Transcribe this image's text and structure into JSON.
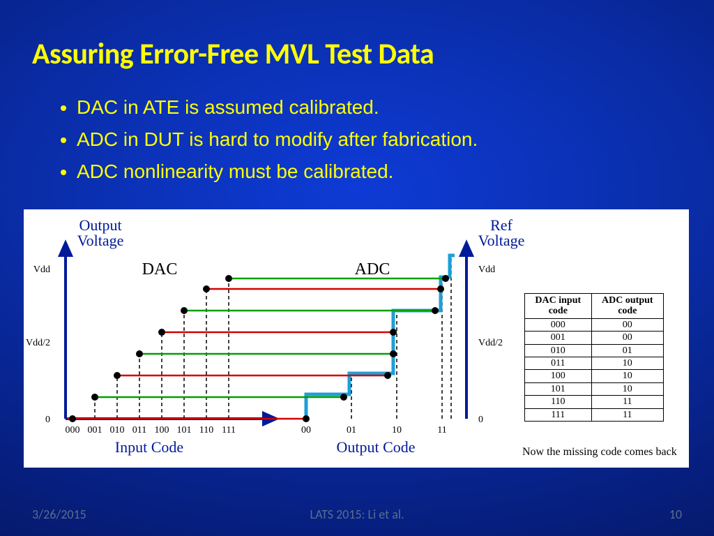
{
  "title": "Assuring Error-Free MVL Test Data",
  "bullets": [
    "DAC in ATE is assumed calibrated.",
    "ADC in DUT is hard to modify after fabrication.",
    "ADC nonlinearity must be calibrated."
  ],
  "figure": {
    "left_ylabel_top": "Output",
    "left_ylabel_bot": "Voltage",
    "right_ylabel_top": "Ref",
    "right_ylabel_bot": "Voltage",
    "dac_label": "DAC",
    "adc_label": "ADC",
    "left_xlabel": "Input Code",
    "right_xlabel": "Output Code",
    "y_ticks": [
      "Vdd",
      "Vdd/2",
      "0"
    ],
    "dac_x_ticks": [
      "000",
      "001",
      "010",
      "011",
      "100",
      "101",
      "110",
      "111"
    ],
    "adc_x_ticks": [
      "00",
      "01",
      "10",
      "11"
    ]
  },
  "chart_data": {
    "type": "line",
    "title": "DAC/ADC transfer and calibration",
    "left_plot": {
      "x": [
        "000",
        "001",
        "010",
        "011",
        "100",
        "101",
        "110",
        "111"
      ],
      "voltage_fraction": [
        0,
        0.143,
        0.286,
        0.429,
        0.571,
        0.714,
        0.857,
        1.0
      ],
      "color_cycle": [
        "red",
        "green",
        "red",
        "green",
        "red",
        "green",
        "red",
        "green"
      ]
    },
    "adc_steps": {
      "x": [
        "00",
        "01",
        "10",
        "11"
      ],
      "riser_position_fraction": [
        0.0,
        0.25,
        0.5,
        0.9
      ]
    },
    "ylim_note": "0 to Vdd, Vdd/2 midpoint"
  },
  "code_table": {
    "headers": [
      "DAC input code",
      "ADC output code"
    ],
    "rows": [
      {
        "dac": "000",
        "adc": "00",
        "red": true
      },
      {
        "dac": "001",
        "adc": "00",
        "red": false
      },
      {
        "dac": "010",
        "adc": "01",
        "red": true
      },
      {
        "dac": "011",
        "adc": "10",
        "red": false
      },
      {
        "dac": "100",
        "adc": "10",
        "red": true
      },
      {
        "dac": "101",
        "adc": "10",
        "red": false
      },
      {
        "dac": "110",
        "adc": "11",
        "red": false
      },
      {
        "dac": "111",
        "adc": "11",
        "red": true
      }
    ],
    "caption": "Now the missing code comes back"
  },
  "footer": {
    "date": "3/26/2015",
    "center": "LATS 2015: Li et al.",
    "page": "10"
  }
}
